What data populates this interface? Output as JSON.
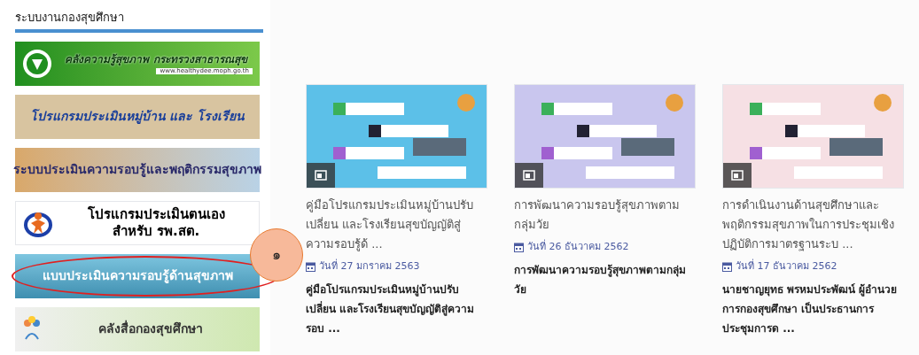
{
  "sidebar": {
    "title": "ระบบงานกองสุขศึกษา",
    "banners": [
      {
        "kind": "green",
        "lines": [
          "คลังความรู้สุขภาพ กระทรวงสาธารณสุข"
        ],
        "url": "www.healthydee.moph.go.th",
        "circled": false
      },
      {
        "kind": "tan",
        "lines": [
          "โปรแกรมประเมินหมู่บ้าน และ โรงเรียน"
        ],
        "circled": false
      },
      {
        "kind": "town",
        "lines": [
          "ระบบประเมินความรอบรู้และพฤติกรรมสุขภาพ"
        ],
        "circled": false
      },
      {
        "kind": "white",
        "lines": [
          "โปรแกรมประเมินตนเอง",
          "สำหรับ รพ.สต."
        ],
        "circled": false
      },
      {
        "kind": "sky",
        "lines": [
          "แบบประเมินความรอบรู้ด้านสุขภาพ"
        ],
        "circled": true
      },
      {
        "kind": "media",
        "lines": [
          "คลังสื่อกองสุขศึกษา"
        ],
        "circled": false
      }
    ]
  },
  "callout": {
    "label": "๑"
  },
  "articles": [
    {
      "kind": "picture",
      "title": "คู่มือโปรแกรมประเมินหมู่บ้านปรับเปลี่ยน และโรงเรียนสุขบัญญัติสู่ความรอบรู้ด้ ...",
      "date": "วันที่ 27 มกราคม 2563",
      "summary": "คู่มือโปรแกรมประเมินหมู่บ้านปรับเปลี่ยน และโรงเรียนสุขบัญญัติสู่ความรอบ ..."
    },
    {
      "kind": "picture",
      "title": "การพัฒนาความรอบรู้สุขภาพตามกลุ่มวัย",
      "date": "วันที่ 26 ธันวาคม 2562",
      "summary": "การพัฒนาความรอบรู้สุขภาพตามกลุ่มวัย"
    },
    {
      "kind": "picture",
      "title": "การดำเนินงานด้านสุขศึกษาและพฤติกรรมสุขภาพในการประชุมเชิงปฏิบัติการมาตรฐานระบ ...",
      "date": "วันที่ 17 ธันวาคม 2562",
      "summary": "นายชาญยุทธ พรหมประพัฒน์ ผู้อำนวยการกองสุขศึกษา เป็นประธานการประชุมการด ..."
    }
  ]
}
